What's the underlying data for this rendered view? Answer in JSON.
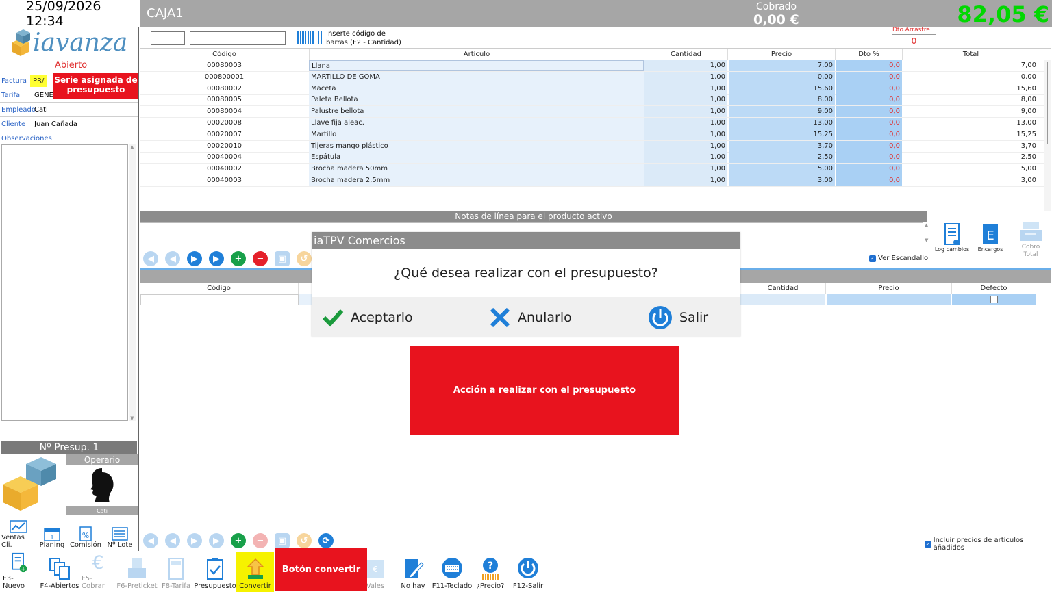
{
  "header": {
    "datetime": "25/09/2026 12:34",
    "caja": "CAJA1",
    "cobrado_label": "Cobrado",
    "cobrado_value": "0,00 €",
    "total_value": "82,05 €",
    "barcode_hint": "Inserte código de barras (F2 - Cantidad)",
    "dto_arrastre_label": "Dto.Arrastre",
    "dto_arrastre_value": "0"
  },
  "left": {
    "brand": "iavanza",
    "status": "Abierto",
    "factura_label": "Factura",
    "factura_value": "PR/",
    "serie_banner": "Serie asignada de presupuesto",
    "tarifa_label": "Tarifa",
    "tarifa_value": "GENE",
    "empleado_label": "Empleado",
    "empleado_value": "Cati",
    "cliente_label": "Cliente",
    "cliente_value": "Juan Cañada",
    "observaciones_label": "Observaciones",
    "presup_number": "Nº Presup. 1",
    "operario_label": "Operario",
    "operario_name": "Cati",
    "buttons": [
      "Ventas Cli.",
      "Planing",
      "Comisión",
      "Nº Lote"
    ]
  },
  "table": {
    "columns": [
      "Código",
      "Artículo",
      "Cantidad",
      "Precio",
      "Dto %",
      "Total"
    ],
    "rows": [
      {
        "code": "00080003",
        "article": "Llana",
        "qty": "1,00",
        "price": "7,00",
        "dto": "0,0",
        "total": "7,00"
      },
      {
        "code": "000800001",
        "article": "MARTILLO DE GOMA",
        "qty": "1,00",
        "price": "0,00",
        "dto": "0,0",
        "total": "0,00"
      },
      {
        "code": "00080002",
        "article": "Maceta",
        "qty": "1,00",
        "price": "15,60",
        "dto": "0,0",
        "total": "15,60"
      },
      {
        "code": "00080005",
        "article": "Paleta Bellota",
        "qty": "1,00",
        "price": "8,00",
        "dto": "0,0",
        "total": "8,00"
      },
      {
        "code": "00080004",
        "article": "Palustre bellota",
        "qty": "1,00",
        "price": "9,00",
        "dto": "0,0",
        "total": "9,00"
      },
      {
        "code": "00020008",
        "article": "Llave fija aleac.",
        "qty": "1,00",
        "price": "13,00",
        "dto": "0,0",
        "total": "13,00"
      },
      {
        "code": "00020007",
        "article": "Martillo",
        "qty": "1,00",
        "price": "15,25",
        "dto": "0,0",
        "total": "15,25"
      },
      {
        "code": "00020010",
        "article": "Tijeras mango plástico",
        "qty": "1,00",
        "price": "3,70",
        "dto": "0,0",
        "total": "3,70"
      },
      {
        "code": "00040004",
        "article": "Espátula",
        "qty": "1,00",
        "price": "2,50",
        "dto": "0,0",
        "total": "2,50"
      },
      {
        "code": "00040002",
        "article": "Brocha madera 50mm",
        "qty": "1,00",
        "price": "5,00",
        "dto": "0,0",
        "total": "5,00"
      },
      {
        "code": "00040003",
        "article": "Brocha madera 2,5mm",
        "qty": "1,00",
        "price": "3,00",
        "dto": "0,0",
        "total": "3,00"
      }
    ]
  },
  "notas_label": "Notas de línea para el producto activo",
  "side_actions": {
    "log": "Log cambios",
    "encargos": "Encargos",
    "cobro_total": "Cobro Total",
    "ver_escandallo": "Ver Escandallo"
  },
  "grid2": {
    "columns": [
      "Código",
      "Cantidad",
      "Precio",
      "Defecto"
    ],
    "incluir_precios": "Incluir precios de artículos añadidos"
  },
  "dialog": {
    "title": "iaTPV Comercios",
    "question": "¿Qué desea realizar con el presupuesto?",
    "accept": "Aceptarlo",
    "cancel": "Anularlo",
    "exit": "Salir"
  },
  "callouts": {
    "accion": "Acción a realizar con el presupuesto",
    "convertir": "Botón convertir"
  },
  "toolbar": {
    "items": [
      "F3-Nuevo",
      "F4-Abiertos",
      "F5-Cobrar",
      "F6-Preticket",
      "F8-Tarifa",
      "Presupuesto",
      "Convertir",
      "Vales",
      "No hay",
      "F11-Teclado",
      "¿Precio?",
      "F12-Salir"
    ]
  }
}
